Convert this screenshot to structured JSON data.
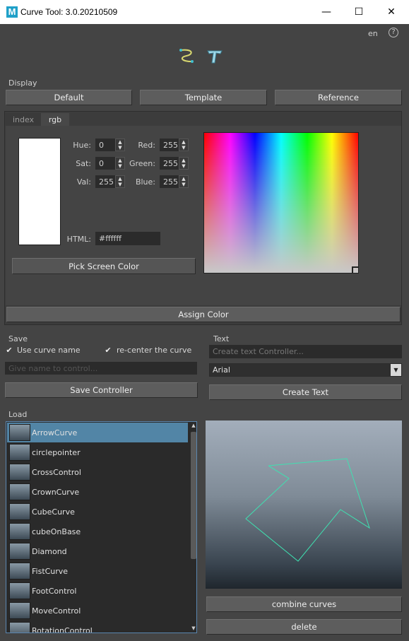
{
  "window": {
    "logo_letter": "M",
    "title": "Curve Tool: 3.0.20210509",
    "minimize_glyph": "—",
    "maximize_glyph": "☐",
    "close_glyph": "✕"
  },
  "header": {
    "language": "en",
    "help_glyph": "?"
  },
  "display": {
    "label": "Display",
    "buttons": [
      "Default",
      "Template",
      "Reference"
    ]
  },
  "color_tabs": {
    "tabs": [
      "index",
      "rgb"
    ],
    "active": "rgb"
  },
  "color": {
    "hue_label": "Hue:",
    "hue": "0",
    "sat_label": "Sat:",
    "sat": "0",
    "val_label": "Val:",
    "val": "255",
    "red_label": "Red:",
    "red": "255",
    "green_label": "Green:",
    "green": "255",
    "blue_label": "Blue:",
    "blue": "255",
    "html_label": "HTML:",
    "html": "#ffffff",
    "swatch": "#ffffff",
    "pick_label": "Pick Screen Color",
    "assign_label": "Assign Color"
  },
  "save": {
    "label": "Save",
    "use_curve_name": "Use curve name",
    "recenter": "re-center the curve",
    "name_placeholder": "Give name to control...",
    "save_button": "Save Controller"
  },
  "text": {
    "label": "Text",
    "text_placeholder": "Create text Controller...",
    "font": "Arial",
    "create_button": "Create Text"
  },
  "load": {
    "label": "Load",
    "items": [
      "ArrowCurve",
      "circlepointer",
      "CrossControl",
      "CrownCurve",
      "CubeCurve",
      "cubeOnBase",
      "Diamond",
      "FistCurve",
      "FootControl",
      "MoveControl",
      "RotationControl"
    ],
    "selected": "ArrowCurve",
    "combine_button": "combine curves",
    "delete_button": "delete"
  },
  "colors": {
    "accent": "#5285a6",
    "preview_curve": "#3fe0b0"
  }
}
